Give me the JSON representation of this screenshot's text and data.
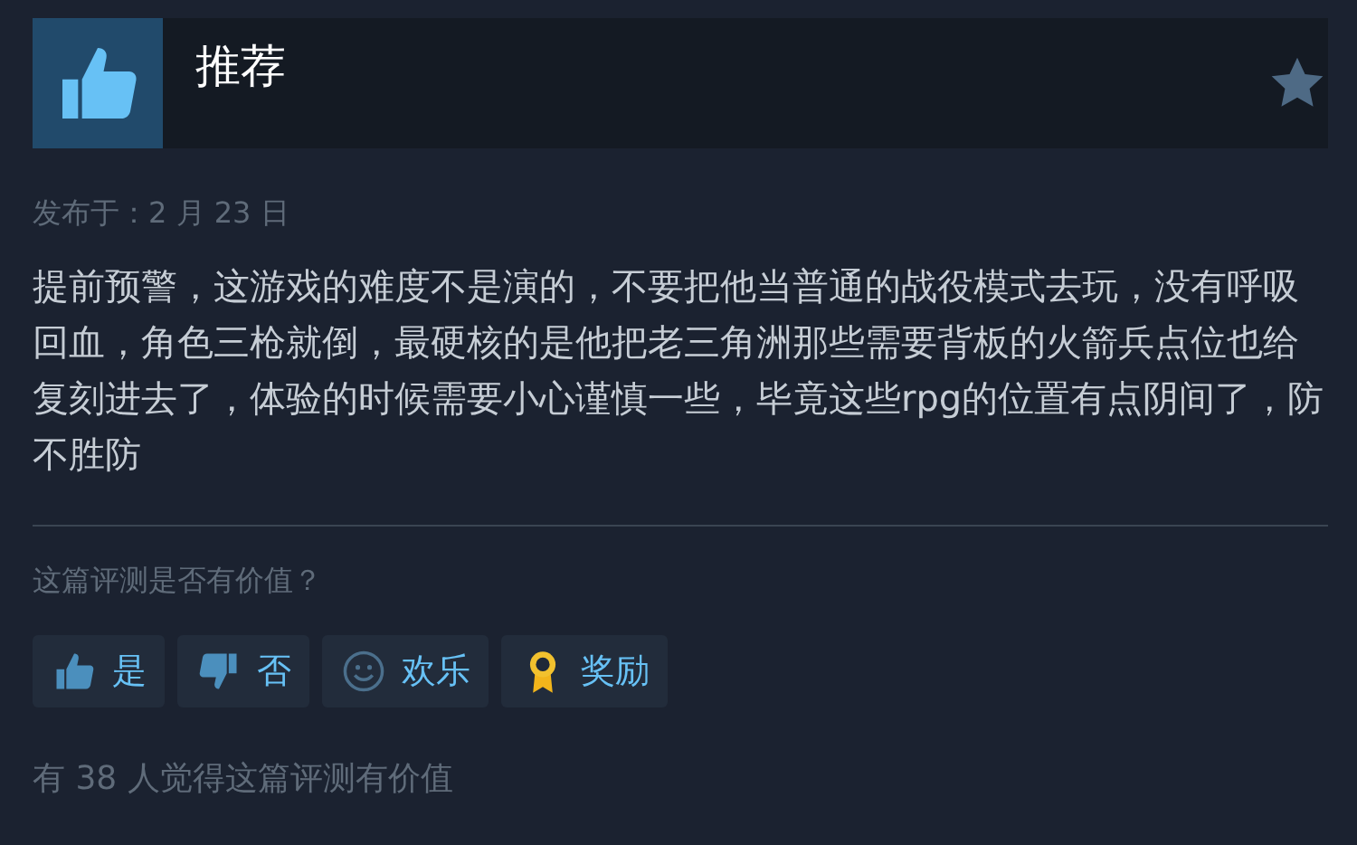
{
  "review": {
    "title": "推荐",
    "posted": "发布于：2 月 23 日",
    "body": "提前预警，这游戏的难度不是演的，不要把他当普通的战役模式去玩，没有呼吸回血，角色三枪就倒，最硬核的是他把老三角洲那些需要背板的火箭兵点位也给复刻进去了，体验的时候需要小心谨慎一些，毕竟这些rpg的位置有点阴间了，防不胜防"
  },
  "helpful": {
    "question": "这篇评测是否有价值？",
    "buttons": [
      {
        "kind": "yes",
        "label": "是"
      },
      {
        "kind": "no",
        "label": "否"
      },
      {
        "kind": "funny",
        "label": "欢乐"
      },
      {
        "kind": "award",
        "label": "奖励"
      }
    ],
    "summary": "有 38 人觉得这篇评测有价值"
  }
}
